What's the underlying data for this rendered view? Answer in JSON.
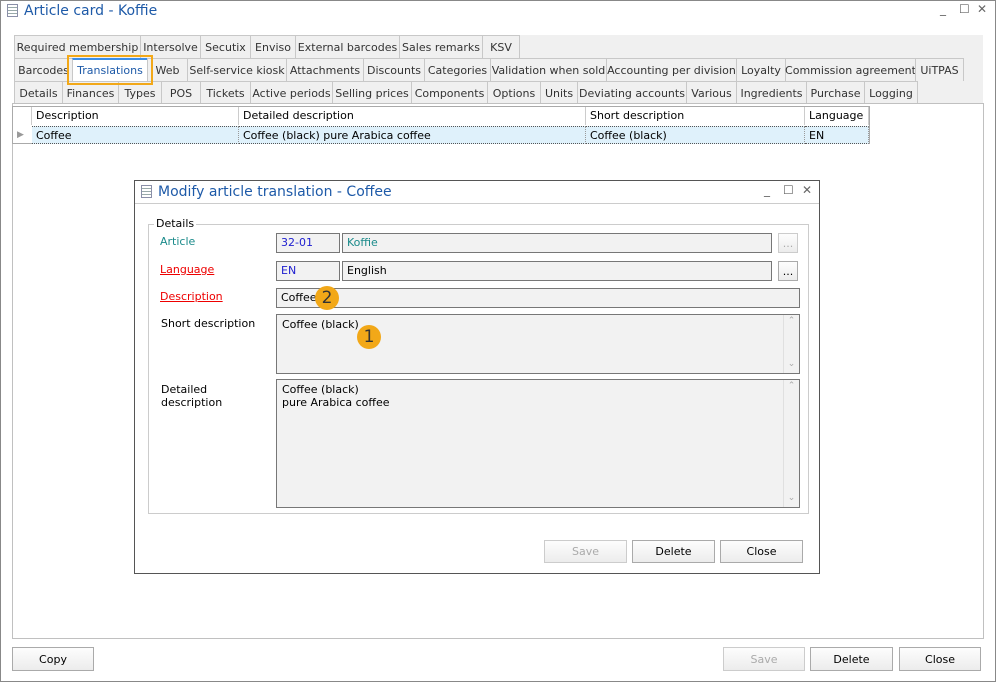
{
  "window": {
    "title": "Article card - Koffie"
  },
  "tabs": {
    "row1": [
      "Required membership",
      "Intersolve",
      "Secutix",
      "Enviso",
      "External barcodes",
      "Sales remarks",
      "KSV"
    ],
    "row2": [
      "Barcodes",
      "Translations",
      "Web",
      "Self-service kiosk",
      "Attachments",
      "Discounts",
      "Categories",
      "Validation when sold",
      "Accounting per division",
      "Loyalty",
      "Commission agreement",
      "UiTPAS"
    ],
    "row3": [
      "Details",
      "Finances",
      "Types",
      "POS",
      "Tickets",
      "Active periods",
      "Selling prices",
      "Components",
      "Options",
      "Units",
      "Deviating accounts",
      "Various",
      "Ingredients",
      "Purchase",
      "Logging"
    ],
    "selected": "Translations",
    "highlight_color": "#f2a818"
  },
  "grid": {
    "columns": [
      "Description",
      "Detailed description",
      "Short description",
      "Language"
    ],
    "rows": [
      [
        "Coffee",
        "Coffee (black) pure Arabica coffee",
        "Coffee (black)",
        "EN"
      ]
    ]
  },
  "dialog": {
    "title": "Modify article translation - Coffee",
    "group": "Details",
    "article_label": "Article",
    "article_code": "32-01",
    "article_name": "Koffie",
    "language_label": "Language",
    "language_code": "EN",
    "language_name": "English",
    "description_label": "Description",
    "description_value": "Coffee",
    "short_label": "Short description",
    "short_value": "Coffee (black)",
    "detailed_label": "Detailed\ndescription",
    "detailed_value": "Coffee (black)\npure Arabica coffee",
    "browse": "...",
    "save": "Save",
    "delete": "Delete",
    "close": "Close",
    "badges": [
      "1",
      "2"
    ]
  },
  "footer": {
    "copy": "Copy",
    "save": "Save",
    "delete": "Delete",
    "close": "Close"
  }
}
